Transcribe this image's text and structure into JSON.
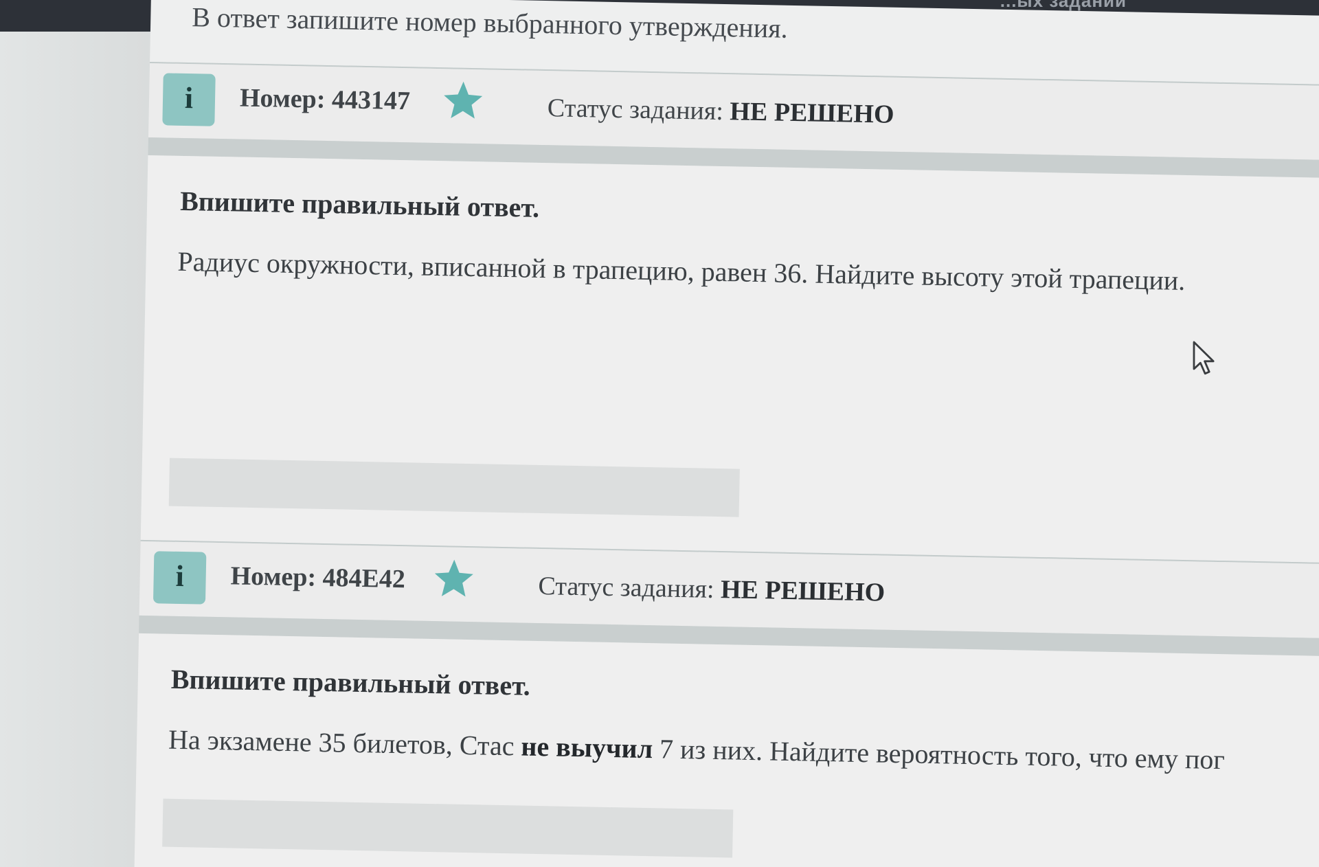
{
  "topbar": {
    "partial_text": "...ых заданий"
  },
  "previous_task": {
    "trailing_text": "В ответ запишите номер выбранного утверждения."
  },
  "tasks": [
    {
      "info_label": "i",
      "number_label": "Номер: 443147",
      "status_label": "Статус задания:",
      "status_value": "НЕ РЕШЕНО",
      "instruction": "Впишите правильный ответ.",
      "question": "Радиус окружности, вписанной в трапецию, равен 36. Найдите высоту этой трапеции.",
      "answer_value": ""
    },
    {
      "info_label": "i",
      "number_label": "Номер: 484E42",
      "status_label": "Статус задания:",
      "status_value": "НЕ РЕШЕНО",
      "instruction": "Впишите правильный ответ.",
      "question_part1": "На экзамене 35 билетов, Стас ",
      "question_bold": "не выучил",
      "question_part2": " 7 из них. Найдите вероятность того, что ему пог",
      "answer_value": ""
    }
  ],
  "colors": {
    "accent_teal": "#8ec5c2",
    "star_teal": "#5fb3b0",
    "topbar_bg": "#2d3138"
  },
  "icons": {
    "info": "info-icon",
    "star": "star-icon",
    "cursor": "mouse-pointer-icon"
  }
}
